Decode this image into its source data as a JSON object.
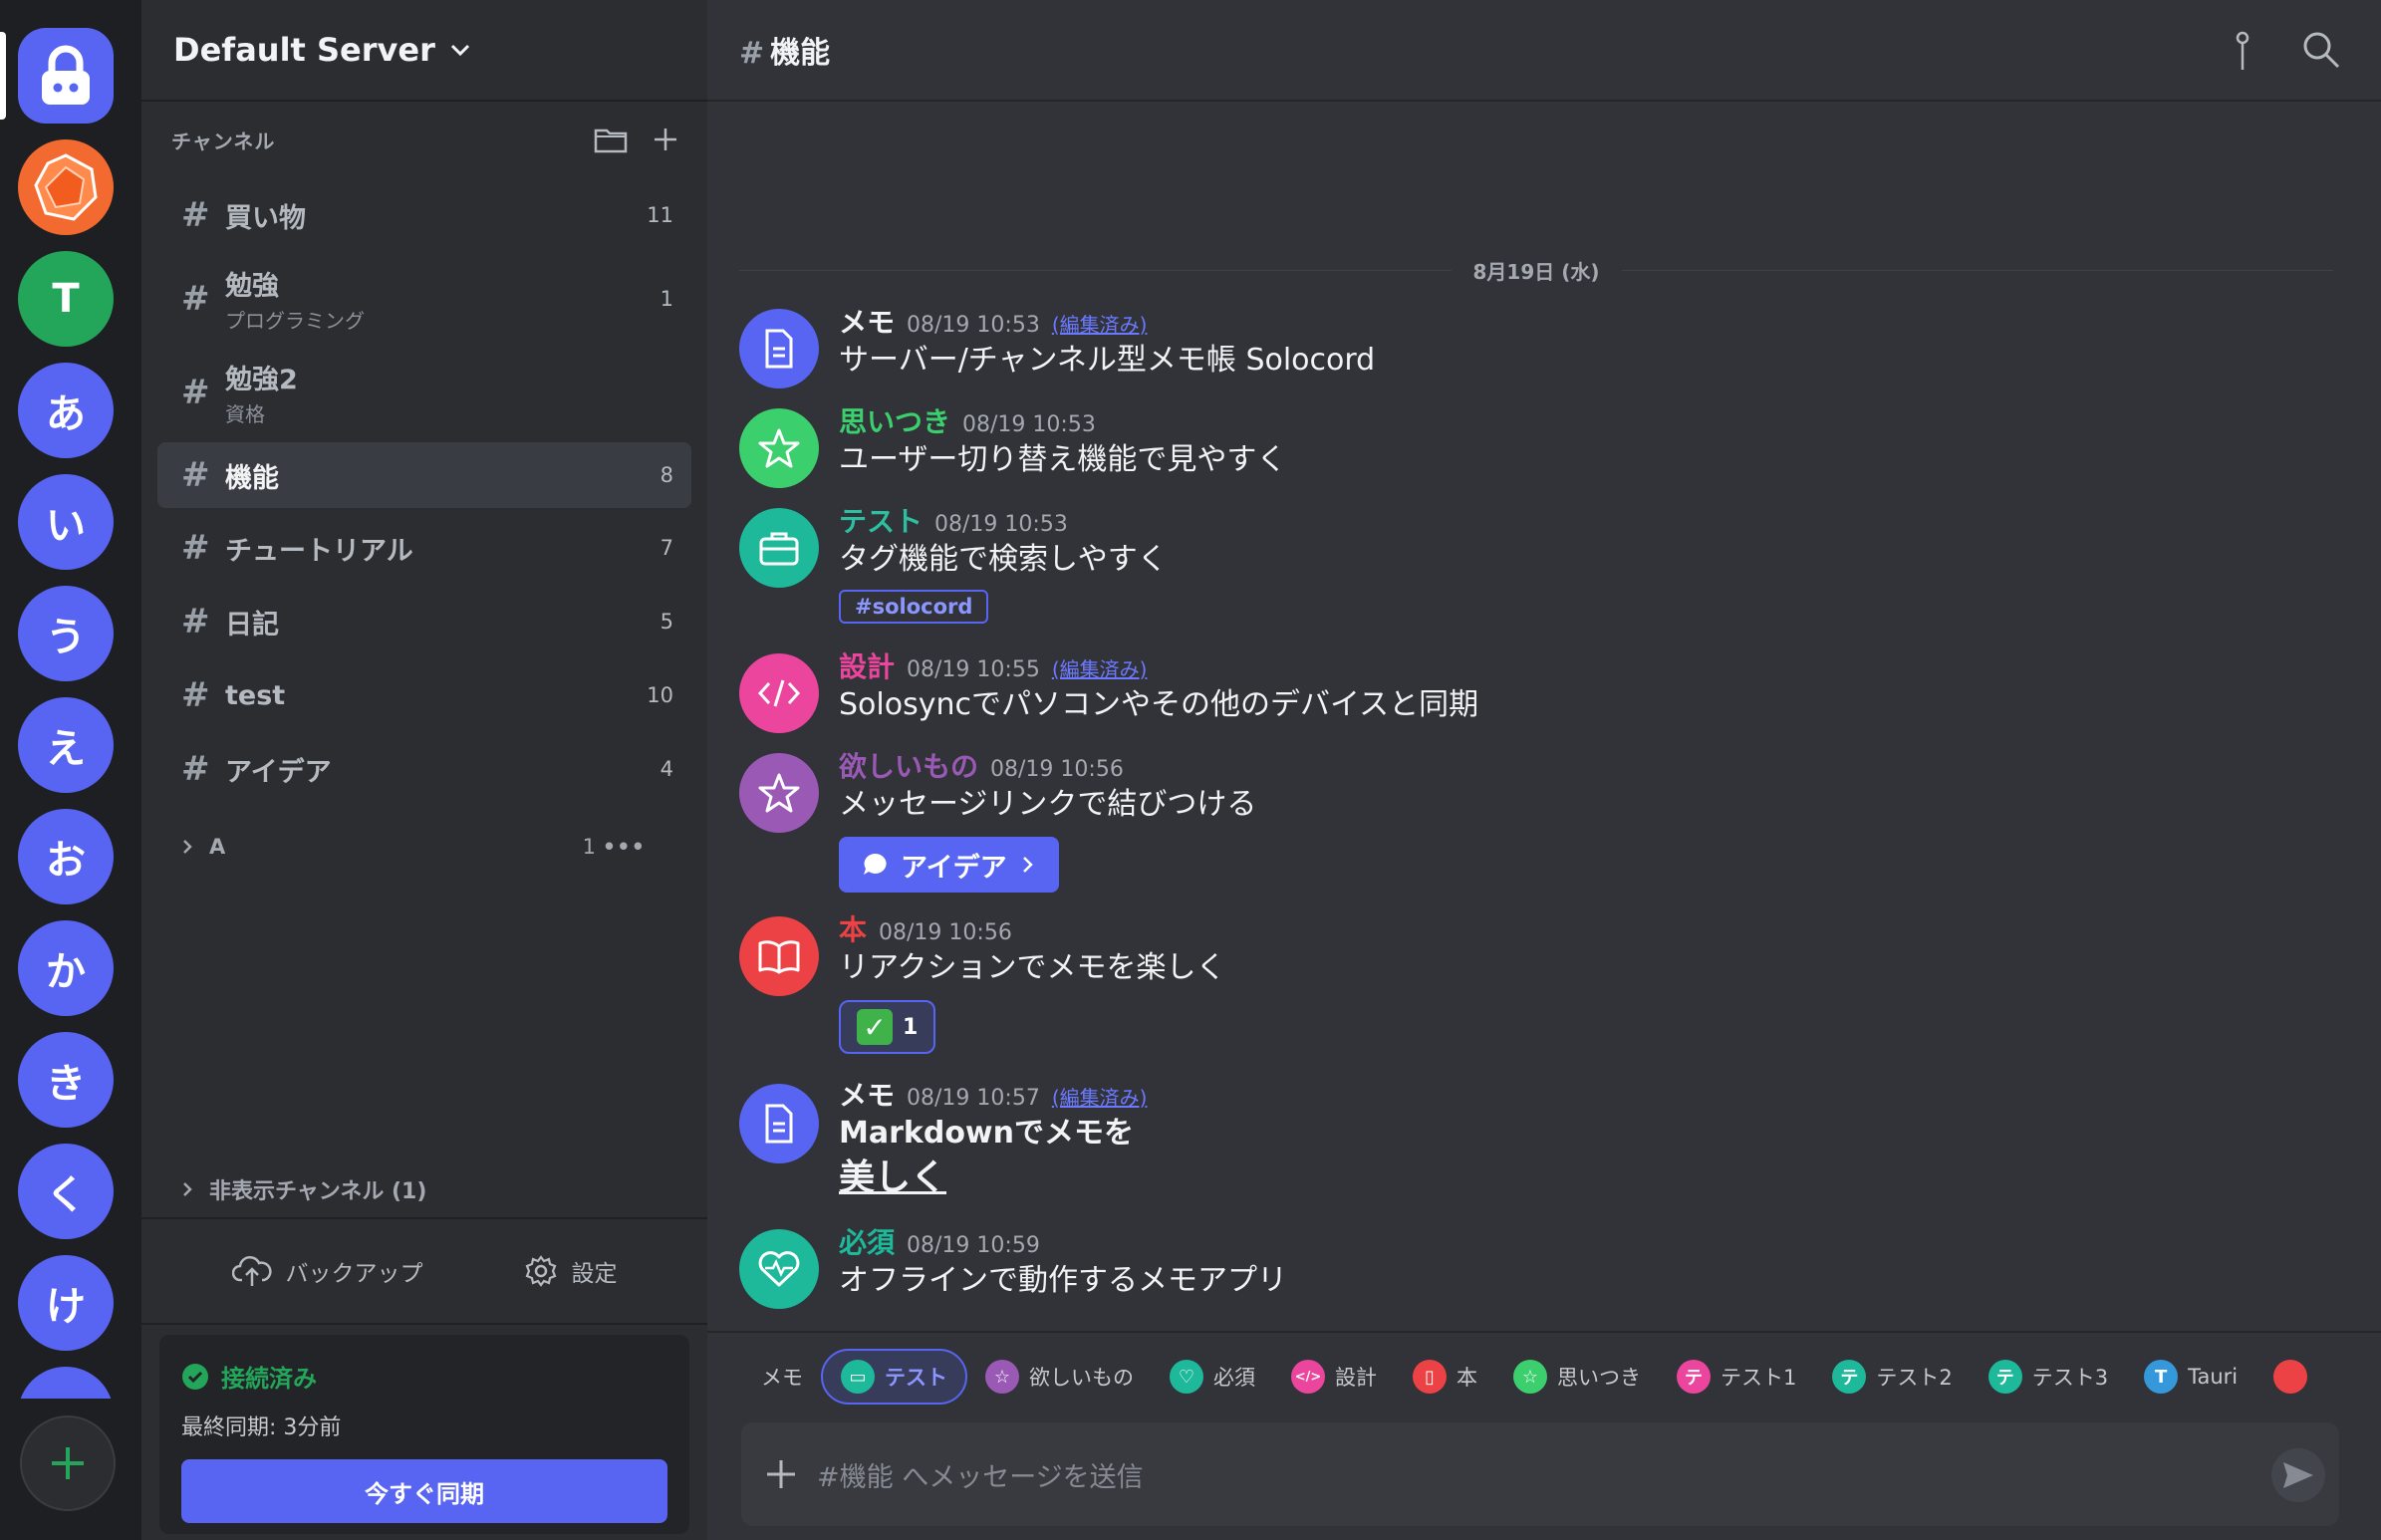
{
  "rail": {
    "servers": [
      {
        "label": "",
        "icon": "lock-icon",
        "color": "#5865f2"
      },
      {
        "label": "",
        "icon": "polygon-logo-icon",
        "color": "#f26a2f"
      },
      {
        "label": "T",
        "color": "#23a55a"
      },
      {
        "label": "あ",
        "color": "#5865f2"
      },
      {
        "label": "い",
        "color": "#5865f2"
      },
      {
        "label": "う",
        "color": "#5865f2"
      },
      {
        "label": "え",
        "color": "#5865f2"
      },
      {
        "label": "お",
        "color": "#5865f2"
      },
      {
        "label": "か",
        "color": "#5865f2"
      },
      {
        "label": "き",
        "color": "#5865f2"
      },
      {
        "label": "く",
        "color": "#5865f2"
      },
      {
        "label": "け",
        "color": "#5865f2"
      }
    ],
    "add_icon": "plus-icon"
  },
  "sidebar": {
    "server_name": "Default Server",
    "section_label": "チャンネル",
    "channels": [
      {
        "name": "買い物",
        "sub": "",
        "count": "11"
      },
      {
        "name": "勉強",
        "sub": "プログラミング",
        "count": "1"
      },
      {
        "name": "勉強2",
        "sub": "資格",
        "count": ""
      },
      {
        "name": "機能",
        "sub": "",
        "count": "8",
        "active": true
      },
      {
        "name": "チュートリアル",
        "sub": "",
        "count": "7"
      },
      {
        "name": "日記",
        "sub": "",
        "count": "5"
      },
      {
        "name": "test",
        "sub": "",
        "count": "10"
      },
      {
        "name": "アイデア",
        "sub": "",
        "count": "4"
      }
    ],
    "category": {
      "name": "A",
      "count": "1"
    },
    "hidden_channels": "非表示チャンネル (1)",
    "backup_label": "バックアップ",
    "settings_label": "設定",
    "sync": {
      "status": "接続済み",
      "last_sync": "最終同期: 3分前",
      "button": "今すぐ同期"
    }
  },
  "main": {
    "channel_title": "機能",
    "date_divider": "8月19日 (水)",
    "edited_label": "(編集済み)",
    "messages": [
      {
        "author": "メモ",
        "author_color": "#f2f3f5",
        "time": "08/19 10:53",
        "edited": true,
        "content": "サーバー/チャンネル型メモ帳 Solocord",
        "avatar_color": "#5865f2",
        "avatar_icon": "document-icon"
      },
      {
        "author": "思いつき",
        "author_color": "#3ccf6e",
        "time": "08/19 10:53",
        "edited": false,
        "content": "ユーザー切り替え機能で見やすく",
        "avatar_color": "#3ccf6e",
        "avatar_icon": "star-icon"
      },
      {
        "author": "テスト",
        "author_color": "#2dbf9f",
        "time": "08/19 10:53",
        "edited": false,
        "content": "タグ機能で検索しやすく",
        "avatar_color": "#1eb89a",
        "avatar_icon": "briefcase-icon",
        "tag": "#solocord"
      },
      {
        "author": "設計",
        "author_color": "#eb459e",
        "time": "08/19 10:55",
        "edited": true,
        "content": "Solosyncでパソコンやその他のデバイスと同期",
        "avatar_color": "#eb459e",
        "avatar_icon": "code-icon"
      },
      {
        "author": "欲しいもの",
        "author_color": "#9b59b6",
        "time": "08/19 10:56",
        "edited": false,
        "content": "メッセージリンクで結びつける",
        "avatar_color": "#9b59b6",
        "avatar_icon": "star-icon",
        "link_button": "アイデア"
      },
      {
        "author": "本",
        "author_color": "#ed4245",
        "time": "08/19 10:56",
        "edited": false,
        "content": "リアクションでメモを楽しく",
        "avatar_color": "#ed4245",
        "avatar_icon": "book-icon",
        "reaction_count": "1"
      },
      {
        "author": "メモ",
        "author_color": "#f2f3f5",
        "time": "08/19 10:57",
        "edited": true,
        "content": "Markdownでメモを",
        "content2": "美しく",
        "avatar_color": "#5865f2",
        "avatar_icon": "document-icon"
      },
      {
        "author": "必須",
        "author_color": "#1eb89a",
        "time": "08/19 10:59",
        "edited": false,
        "content": "オフラインで動作するメモアプリ",
        "avatar_color": "#1eb89a",
        "avatar_icon": "heart-pulse-icon"
      }
    ],
    "tagbar": [
      {
        "label": "メモ",
        "color": "",
        "active": false
      },
      {
        "label": "テスト",
        "color": "#1eb89a",
        "active": true,
        "glyph": "▭"
      },
      {
        "label": "欲しいもの",
        "color": "#9b59b6",
        "glyph": "☆"
      },
      {
        "label": "必須",
        "color": "#1eb89a",
        "glyph": "♡"
      },
      {
        "label": "設計",
        "color": "#eb459e",
        "glyph": "</>"
      },
      {
        "label": "本",
        "color": "#ed4245",
        "glyph": "▯"
      },
      {
        "label": "思いつき",
        "color": "#3ccf6e",
        "glyph": "☆"
      },
      {
        "label": "テスト1",
        "color": "#eb459e",
        "glyph": "テ"
      },
      {
        "label": "テスト2",
        "color": "#1eb89a",
        "glyph": "テ"
      },
      {
        "label": "テスト3",
        "color": "#1eb89a",
        "glyph": "テ"
      },
      {
        "label": "Tauri",
        "color": "#3498db",
        "glyph": "T"
      }
    ],
    "composer_placeholder": "#機能 へメッセージを送信"
  }
}
